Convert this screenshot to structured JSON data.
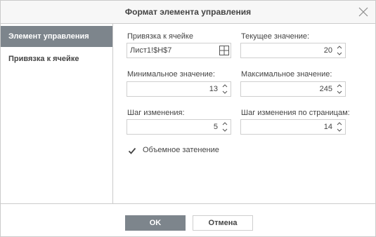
{
  "dialog": {
    "title": "Формат элемента управления"
  },
  "sidebar": {
    "items": [
      {
        "label": "Элемент управления"
      },
      {
        "label": "Привязка к ячейке"
      }
    ]
  },
  "form": {
    "cell_link": {
      "label": "Привязка к ячейке",
      "value": "Лист1!$H$7"
    },
    "current_value": {
      "label": "Текущее значение:",
      "value": "20"
    },
    "min_value": {
      "label": "Минимальное значение:",
      "value": "13"
    },
    "max_value": {
      "label": "Максимальное значение:",
      "value": "245"
    },
    "step": {
      "label": "Шаг изменения:",
      "value": "5"
    },
    "page_step": {
      "label": "Шаг изменения по страницам:",
      "value": "14"
    },
    "shading": {
      "label": "Объемное затенение",
      "checked": true
    }
  },
  "footer": {
    "ok_label": "OK",
    "cancel_label": "Отмена"
  },
  "colors": {
    "accent": "#7d858c",
    "border": "#cbcbcb",
    "text": "#444444"
  }
}
